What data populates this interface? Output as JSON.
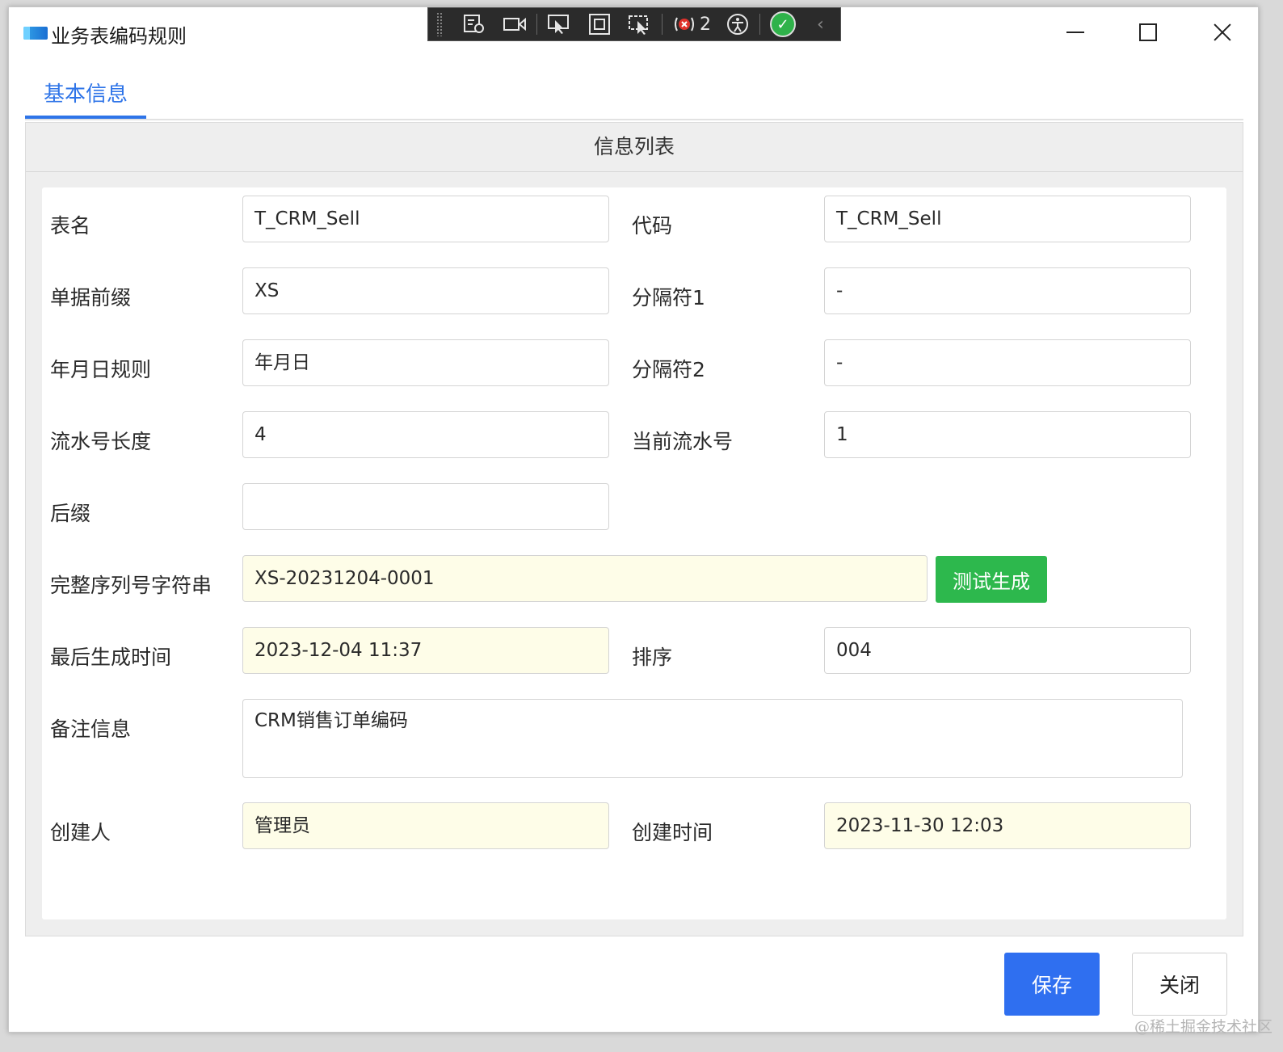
{
  "window": {
    "title": "业务表编码规则"
  },
  "devbar": {
    "error_count": "2"
  },
  "tabs": [
    {
      "label": "基本信息",
      "active": true
    }
  ],
  "panel": {
    "header": "信息列表"
  },
  "form": {
    "table_name": {
      "label": "表名",
      "value": "T_CRM_Sell"
    },
    "code": {
      "label": "代码",
      "value": "T_CRM_Sell"
    },
    "prefix": {
      "label": "单据前缀",
      "value": "XS"
    },
    "sep1": {
      "label": "分隔符1",
      "value": "-"
    },
    "date_rule": {
      "label": "年月日规则",
      "value": "年月日"
    },
    "sep2": {
      "label": "分隔符2",
      "value": "-"
    },
    "serial_len": {
      "label": "流水号长度",
      "value": "4"
    },
    "current_serial": {
      "label": "当前流水号",
      "value": "1"
    },
    "suffix": {
      "label": "后缀",
      "value": ""
    },
    "full_serial": {
      "label": "完整序列号字符串",
      "value": "XS-20231204-0001"
    },
    "test_button": "测试生成",
    "last_gen_time": {
      "label": "最后生成时间",
      "value": "2023-12-04 11:37"
    },
    "sort": {
      "label": "排序",
      "value": "004"
    },
    "remark": {
      "label": "备注信息",
      "value": "CRM销售订单编码"
    },
    "creator": {
      "label": "创建人",
      "value": "管理员"
    },
    "create_time": {
      "label": "创建时间",
      "value": "2023-11-30 12:03"
    }
  },
  "footer": {
    "save": "保存",
    "close": "关闭"
  },
  "watermark": "@稀土掘金技术社区",
  "colors": {
    "accent": "#2e74e8",
    "save_button": "#2f6ff0",
    "generate_button": "#2db84d",
    "readonly_field": "#fefde8"
  }
}
